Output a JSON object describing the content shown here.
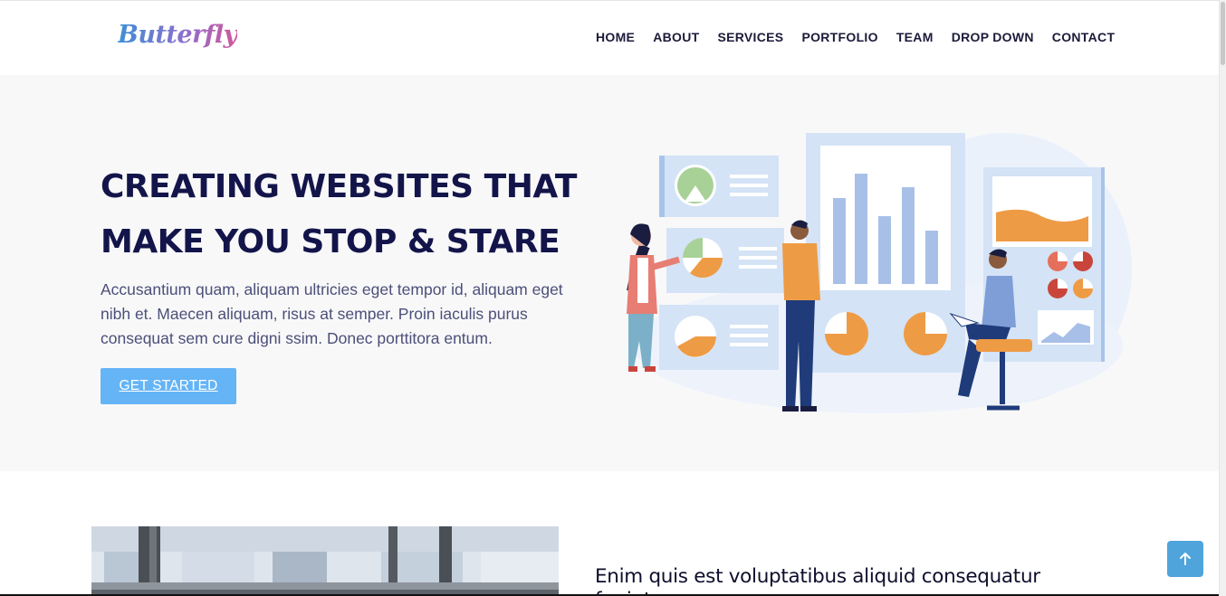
{
  "brand": {
    "logo_text": "Butterfly",
    "accent": "#64b4f6",
    "navy": "#13154a"
  },
  "nav": {
    "items": [
      {
        "label": "HOME"
      },
      {
        "label": "ABOUT"
      },
      {
        "label": "SERVICES"
      },
      {
        "label": "PORTFOLIO"
      },
      {
        "label": "TEAM"
      },
      {
        "label": "DROP DOWN"
      },
      {
        "label": "CONTACT"
      }
    ]
  },
  "hero": {
    "title_line1": "CREATING WEBSITES THAT",
    "title_line2": "MAKE YOU STOP & STARE",
    "description": "Accusantium quam, aliquam ultricies eget tempor id, aliquam eget nibh et. Maecen aliquam, risus at semper. Proin iaculis purus consequat sem cure digni ssim. Donec porttitora entum.",
    "cta_label": "GET STARTED",
    "illustration": "team-analytics-illustration"
  },
  "about": {
    "title_line1": "Enim quis est voluptatibus aliquid consequatur",
    "title_line2": "fugiat",
    "image": "office-window-photo"
  },
  "back_to_top": {
    "icon": "arrow-up-icon"
  }
}
